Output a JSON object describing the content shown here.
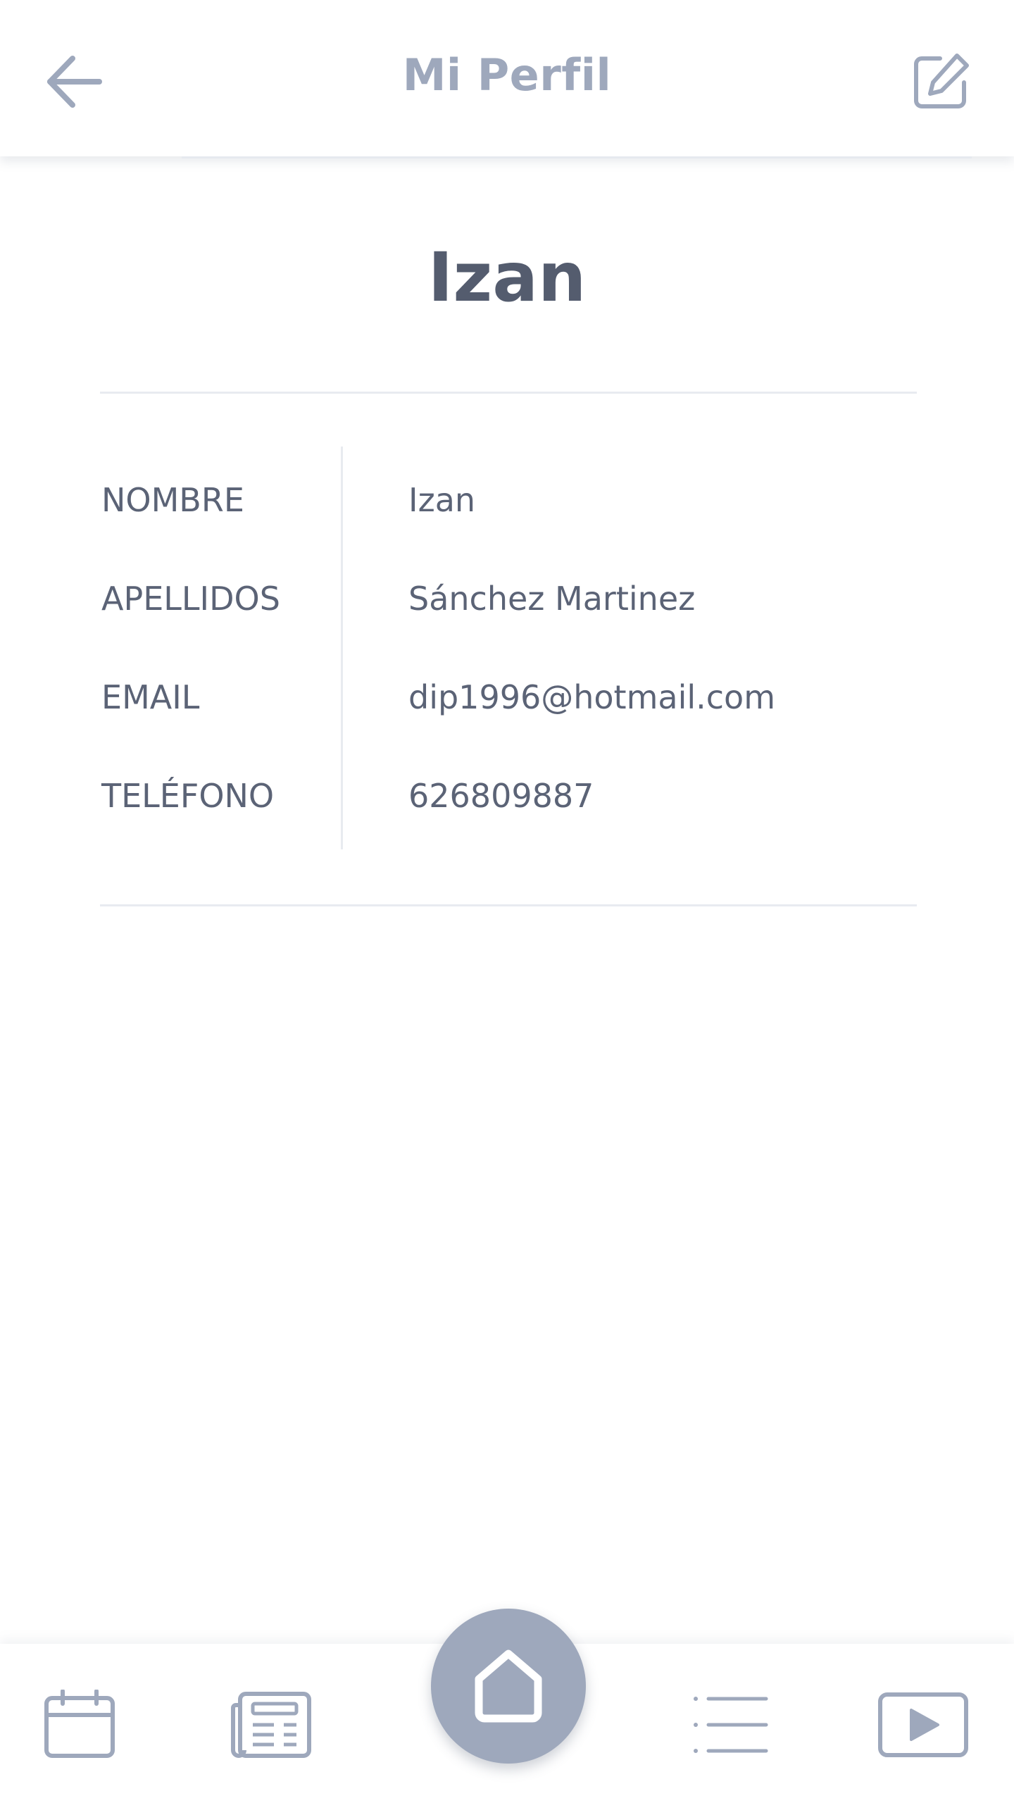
{
  "header": {
    "title": "Mi Perfil",
    "back_icon": "arrow-left-icon",
    "edit_icon": "edit-square-icon"
  },
  "profile": {
    "display_name": "Izan",
    "fields": [
      {
        "label": "NOMBRE",
        "value": "Izan"
      },
      {
        "label": "APELLIDOS",
        "value": "Sánchez Martinez"
      },
      {
        "label": "EMAIL",
        "value": "dip1996@hotmail.com"
      },
      {
        "label": "TELÉFONO",
        "value": "626809887"
      }
    ]
  },
  "bottom_nav": {
    "items": [
      {
        "icon": "calendar-icon"
      },
      {
        "icon": "newspaper-icon"
      },
      {
        "icon": "home-icon"
      },
      {
        "icon": "list-icon"
      },
      {
        "icon": "play-video-icon"
      }
    ]
  },
  "colors": {
    "icon": "#9ea8bc",
    "text": "#5b6376",
    "heading": "#545c6e",
    "divider": "#e8ebf0",
    "home_button": "#9ea8bc"
  }
}
